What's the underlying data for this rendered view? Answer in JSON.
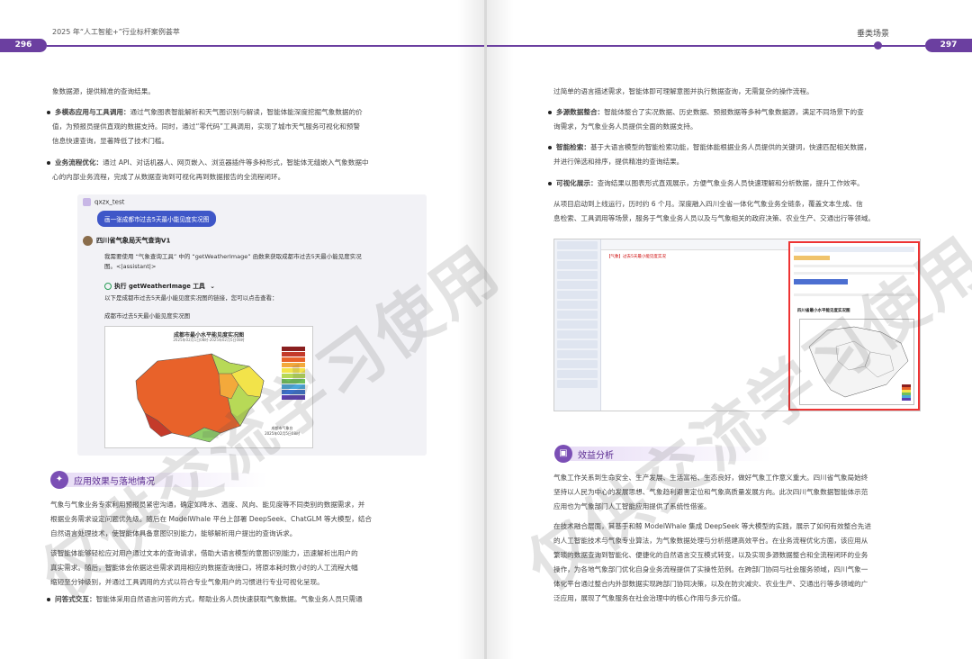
{
  "header": {
    "left_title": "2025 年“人工智能+”行业标杆案例荟萃",
    "right_title": "垂类场景",
    "left_page": "296",
    "right_page": "297"
  },
  "left": {
    "intro": "象数据源，提供精准的查询结果。",
    "bullet1_head": "多模态应用与工具调用：",
    "bullet1_body_l1": "通过气象图表智能解析和天气图识别与解读，智能体能深度挖掘气象数据的价",
    "bullet1_body_l2": "值，为预报员提供直观的数据支持。同时，通过“零代码”工具调用，实现了城市天气服务可视化和预警",
    "bullet1_body_l3": "信息快速查询，显著降低了技术门槛。",
    "bullet2_head": "业务流程优化：",
    "bullet2_body_l1": "通过 API、对话机器人、网页嵌入、浏览器插件等多种形式，智能体无缝嵌入气象数据中",
    "bullet2_body_l2": "心的内部业务流程，完成了从数据查询到可视化再到数据报告的全流程闭环。",
    "chat": {
      "user": "qxzx_test",
      "user_msg": "画一张成都市过去5天最小能见度实况图",
      "bot_name": "四川省气象局天气查询V1",
      "bot_l1": "我需要使用 “气象查询工具” 中的 “getWeatherImage” 函数来获取成都市过去5天最小能见度实况",
      "bot_l2": "图。<|assistant|>",
      "tool": "执行 getWeatherImage 工具",
      "bot_l3": "以下是成都市过去5天最小能见度实况图的链接，您可以点击查看：",
      "bot_l4": "成都市过去5天最小能见度实况图",
      "map_title": "成都市最小水平能见度实况图",
      "map_subtitle": "2025年02月1日08时-2025年02月5日08时",
      "map_footer_l1": "成都市气象台",
      "map_footer_l2": "2025年02月5日08时"
    },
    "section_title": "应用效果与落地情况",
    "p1_l1": "气象与气象业务专家利用预报员紧密沟通，确定如降水、温度、风向、能见度等不同类别的数据需求，并",
    "p1_l2": "根据业务需求设定问题优先级。随后在 ModelWhale 平台上部署 DeepSeek、ChatGLM 等大模型，结合",
    "p1_l3": "自然语言处理技术，使智能体具备意图识别能力，能够解析用户提出的查询诉求。",
    "p2_l1": "该智能体能够轻松应对用户通过文本的查询请求，借助大语言模型的意图识别能力，迅速解析出用户的",
    "p2_l2": "真实需求。随后，智能体会依据这些需求调用相应的数据查询接口，将原本耗时数小时的人工流程大幅",
    "p2_l3": "缩短至分钟级别，并通过工具调用的方式以符合专业气象用户的习惯进行专业可视化呈现。",
    "bullet3_head": "问答式交互：",
    "bullet3_body": "智能体采用自然语言问答的方式，帮助业务人员快速获取气象数据。气象业务人员只需通"
  },
  "right": {
    "intro": "过简单的语言描述需求，智能体即可理解意图并执行数据查询，无需复杂的操作流程。",
    "bullet1_head": "多源数据整合：",
    "bullet1_l1": "智能体整合了实况数据、历史数据、预报数据等多种气象数据源，满足不同场景下的查",
    "bullet1_l2": "询需求，为气象业务人员提供全面的数据支持。",
    "bullet2_head": "智能检索：",
    "bullet2_l1": "基于大语言模型的智能检索功能，智能体能根据业务人员提供的关键词，快速匹配相关数据，",
    "bullet2_l2": "并进行筛选和排序，提供精准的查询结果。",
    "bullet3_head": "可视化展示：",
    "bullet3_l1": "查询结果以图表形式直观展示，方便气象业务人员快速理解和分析数据，提升工作效率。",
    "p1_l1": "从项目启动到上线运行，历时约 6 个月。深度融入四川全省一体化气象业务全链条，覆盖文本生成、信",
    "p1_l2": "息检索、工具调用等场景，服务于气象业务人员以及与气象相关的政府决策、农业生产、交通出行等领域。",
    "shot_red": "【气象】过去5天最小能见度实况",
    "shot_map_title": "四川省最小水平能见度实况图",
    "section_title": "效益分析",
    "p2_l1": "气象工作关系到生命安全、生产发展、生活富裕、生态良好，做好气象工作意义重大。四川省气象局始终",
    "p2_l2": "坚持以人民为中心的发展思想、气象趋利避害定位和气象高质量发展方向。此次四川气象数据智能体示范",
    "p2_l3": "应用也为气象部门人工智能应用提供了系统性借鉴。",
    "p3_l1": "在技术融合层面，其基于和鲸 ModelWhale 集成 DeepSeek 等大模型的实践，展示了如何有效整合先进",
    "p3_l2": "的人工智能技术与气象专业算法，为气象数据处理与分析搭建高效平台。在业务流程优化方面，该应用从",
    "p3_l3": "繁琐的数据查询到智能化、便捷化的自然语言交互模式转变，以及实现多源数据整合和全流程闭环的业务",
    "p3_l4": "操作，为各地气象部门优化自身业务流程提供了实操性范例。在跨部门协同与社会服务领域，四川气象一",
    "p3_l5": "体化平台通过整合内外部数据实现跨部门协同决策，以及在防灾减灾、农业生产、交通出行等多领域的广",
    "p3_l6": "泛应用，展现了气象服务在社会治理中的核心作用与多元价值。"
  },
  "watermark": "仅供交流学习使用",
  "colors": {
    "accent": "#6b3fa0",
    "user_bubble": "#3f57c8",
    "highlight_border": "#e33"
  }
}
